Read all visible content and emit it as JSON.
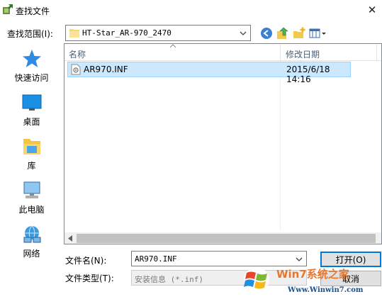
{
  "window": {
    "title": "查找文件",
    "close_glyph": "✕"
  },
  "lookin": {
    "label": "查找范围(I):",
    "value": "HT-Star_AR-970_2470"
  },
  "places": [
    {
      "id": "quick",
      "label": "快速访问"
    },
    {
      "id": "desktop",
      "label": "桌面"
    },
    {
      "id": "library",
      "label": "库"
    },
    {
      "id": "thispc",
      "label": "此电脑"
    },
    {
      "id": "network",
      "label": "网络"
    }
  ],
  "filelist": {
    "col_name": "名称",
    "col_date": "修改日期",
    "files": [
      {
        "name": "AR970.INF",
        "date": "2015/6/18 14:16",
        "selected": true
      }
    ]
  },
  "filename": {
    "label": "文件名(N):",
    "value": "AR970.INF"
  },
  "filetype": {
    "label": "文件类型(T):",
    "value": "安装信息 (*.inf)"
  },
  "buttons": {
    "open": "打开(O)",
    "cancel": "取消"
  },
  "watermark": {
    "brand": "Win7系统之家",
    "url": "Www.Winwin7.com"
  },
  "colors": {
    "selection": "#cce8ff",
    "selection_border": "#99d1ff",
    "accent": "#0078d7",
    "header_text": "#4c607a"
  },
  "icons": [
    "app-icon",
    "close-icon",
    "folder-icon",
    "chevron-down-icon",
    "back-icon",
    "up-folder-icon",
    "new-folder-icon",
    "view-menu-icon",
    "star-icon",
    "desktop-icon",
    "library-icon",
    "computer-icon",
    "network-icon",
    "inf-file-icon",
    "sort-up-icon",
    "scroll-left-icon"
  ]
}
